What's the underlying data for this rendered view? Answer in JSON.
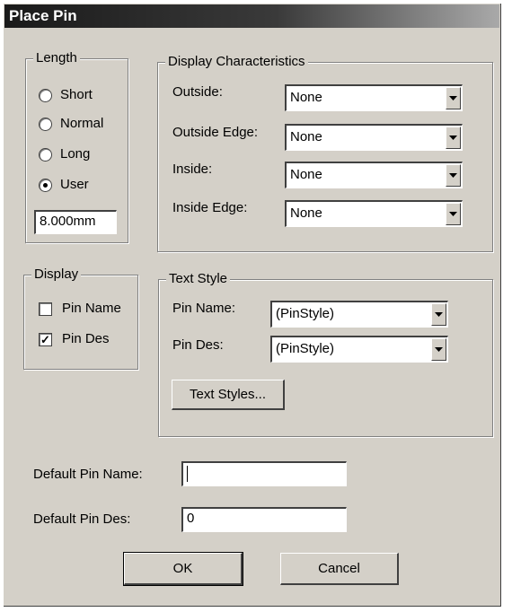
{
  "dialog": {
    "title": "Place Pin"
  },
  "length": {
    "legend": "Length",
    "options": [
      {
        "label": "Short",
        "selected": false
      },
      {
        "label": "Normal",
        "selected": false
      },
      {
        "label": "Long",
        "selected": false
      },
      {
        "label": "User",
        "selected": true
      }
    ],
    "user_value": "8.000mm"
  },
  "display_characteristics": {
    "legend": "Display Characteristics",
    "rows": [
      {
        "label": "Outside:",
        "value": "None"
      },
      {
        "label": "Outside Edge:",
        "value": "None"
      },
      {
        "label": "Inside:",
        "value": "None"
      },
      {
        "label": "Inside Edge:",
        "value": "None"
      }
    ]
  },
  "display": {
    "legend": "Display",
    "items": [
      {
        "label": "Pin Name",
        "checked": false
      },
      {
        "label": "Pin Des",
        "checked": true
      }
    ]
  },
  "text_style": {
    "legend": "Text Style",
    "pin_name_label": "Pin Name:",
    "pin_name_value": "(PinStyle)",
    "pin_des_label": "Pin Des:",
    "pin_des_value": "(PinStyle)",
    "text_styles_button": "Text Styles..."
  },
  "defaults": {
    "pin_name_label": "Default Pin Name:",
    "pin_name_value": "",
    "pin_des_label": "Default Pin Des:",
    "pin_des_value": "0"
  },
  "buttons": {
    "ok": "OK",
    "cancel": "Cancel"
  },
  "check_mark": "✓"
}
